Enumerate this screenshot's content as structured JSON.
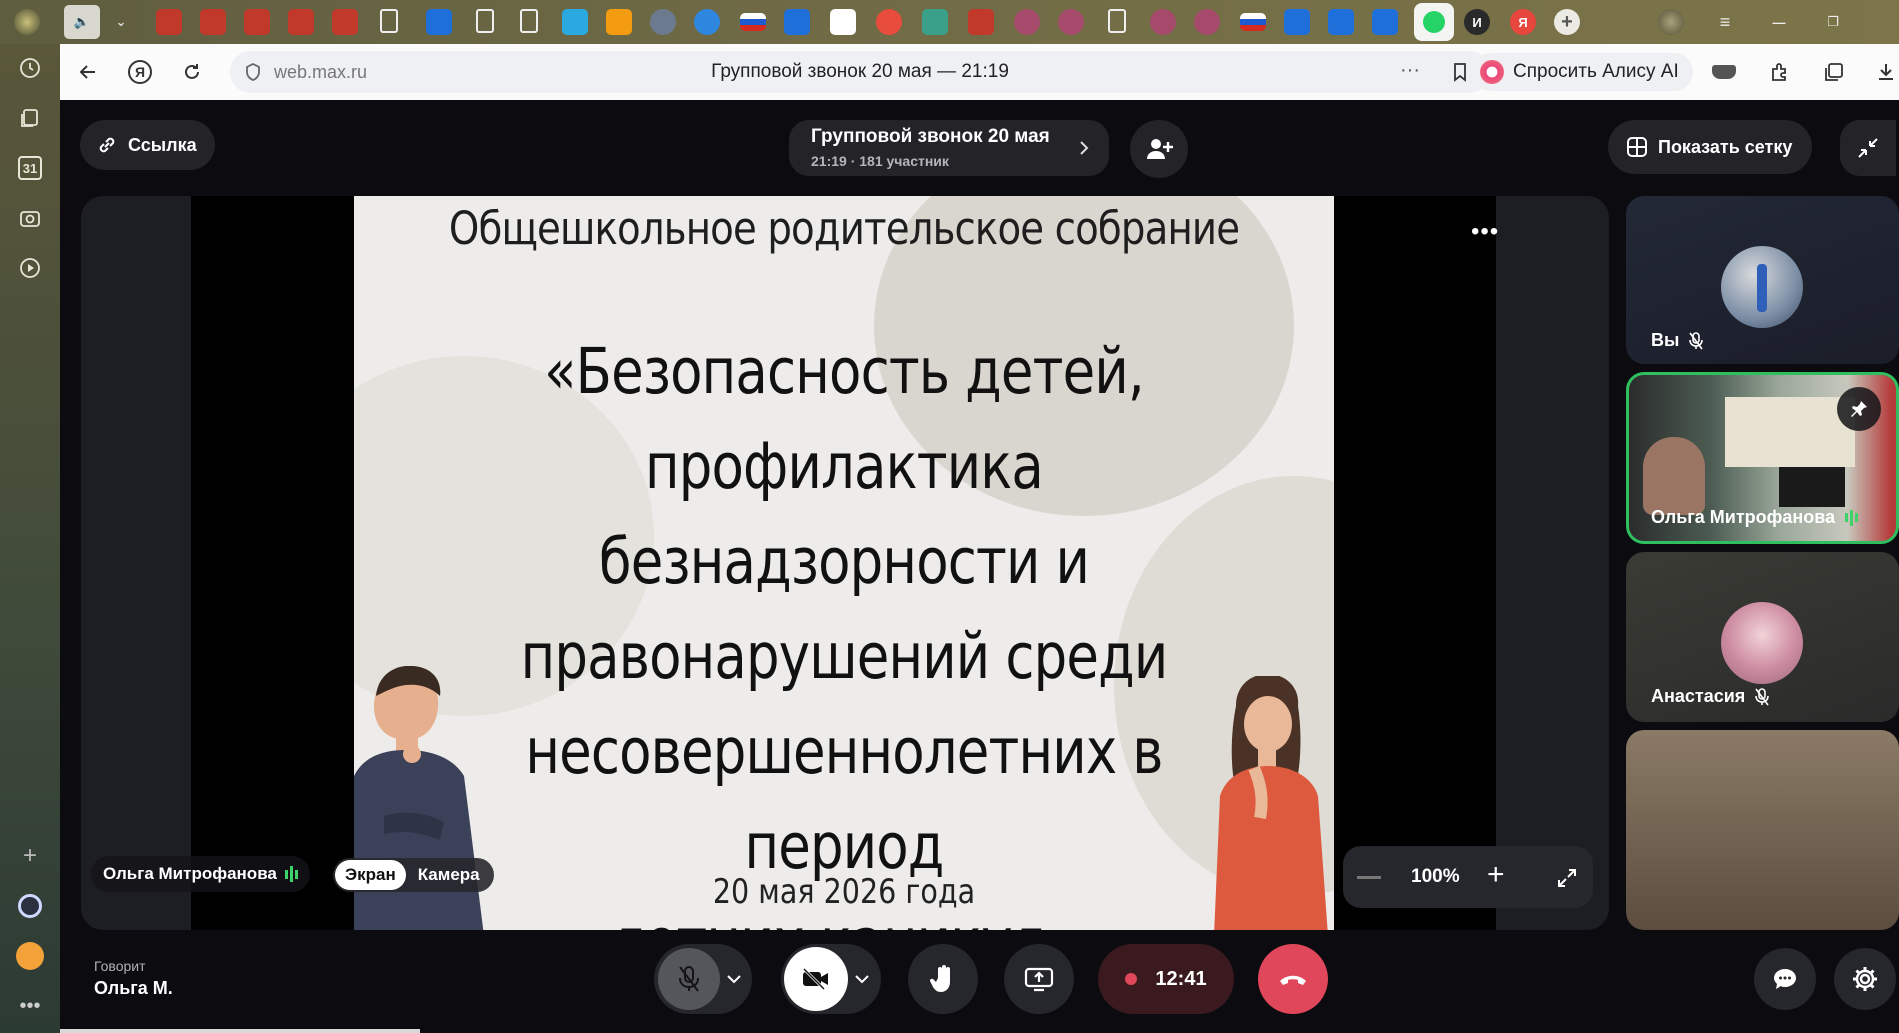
{
  "browser": {
    "address_url": "web.max.ru",
    "page_title": "Групповой звонок 20 мая — 21:19",
    "alice_label": "Спросить Алису AI",
    "calendar_day": "31",
    "tab_letter_i": "И",
    "tab_letter_ya": "Я"
  },
  "call": {
    "link_label": "Ссылка",
    "title": "Групповой звонок 20 мая",
    "subtitle": "21:19 · 181 участник",
    "grid_label": "Показать сетку",
    "presenter_name": "Ольга Митрофанова",
    "source_screen": "Экран",
    "source_camera": "Камера",
    "zoom_level": "100%",
    "speaking_label": "Говорит",
    "speaking_name": "Ольга М.",
    "timer": "12:41"
  },
  "slide": {
    "header": "Общешкольное родительское собрание",
    "title_lines": {
      "l1": "«Безопасность детей,",
      "l2": "профилактика безнадзорности и",
      "l3": "правонарушений среди",
      "l4": "несовершеннолетних в период",
      "l5": "летних каникул»"
    },
    "date": "20 мая 2026 года"
  },
  "participants": [
    {
      "name": "Вы",
      "muted": true
    },
    {
      "name": "Ольга Митрофанова",
      "speaking": true,
      "pinned": true
    },
    {
      "name": "Анастасия",
      "muted": true
    }
  ],
  "colors": {
    "end_call": "#e0475a",
    "record": "#3a1a1e",
    "speaking_green": "#3fd26a",
    "active_border": "#2fbf5f"
  }
}
